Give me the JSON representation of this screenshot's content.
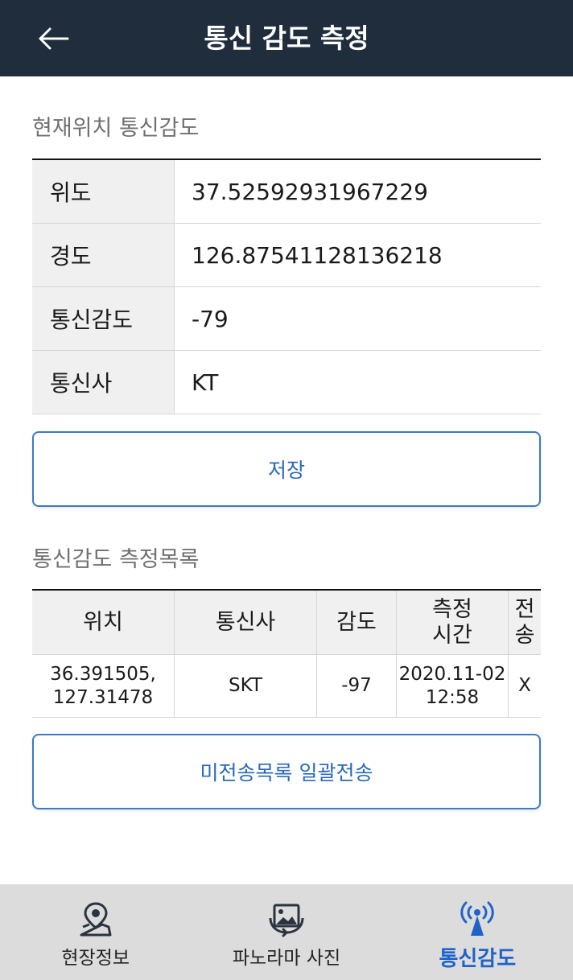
{
  "header": {
    "title": "통신 감도 측정",
    "back_icon": "arrow-left-icon"
  },
  "current": {
    "title": "현재위치 통신감도",
    "rows": [
      {
        "label": "위도",
        "value": "37.52592931967229"
      },
      {
        "label": "경도",
        "value": "126.87541128136218"
      },
      {
        "label": "통신감도",
        "value": "-79"
      },
      {
        "label": "통신사",
        "value": "KT"
      }
    ],
    "save_label": "저장"
  },
  "records": {
    "title": "통신감도 측정목록",
    "columns": [
      "위치",
      "통신사",
      "감도",
      "측정\n시간",
      "전\n송"
    ],
    "rows": [
      {
        "location": "36.391505,\n127.31478",
        "carrier": "SKT",
        "signal": "-97",
        "time": "2020.11-02\n12:58",
        "sent": "X"
      }
    ],
    "send_all_label": "미전송목록 일괄전송"
  },
  "nav": {
    "items": [
      {
        "label": "현장정보",
        "icon": "map-pin-icon"
      },
      {
        "label": "파노라마 사진",
        "icon": "panorama-photo-icon"
      },
      {
        "label": "통신감도",
        "icon": "signal-tower-icon",
        "active": true
      }
    ]
  },
  "colors": {
    "header_bg": "#1f2d3d",
    "accent": "#1f63c9",
    "button_border": "#3c78c8",
    "nav_bg": "#dcdcdc"
  }
}
